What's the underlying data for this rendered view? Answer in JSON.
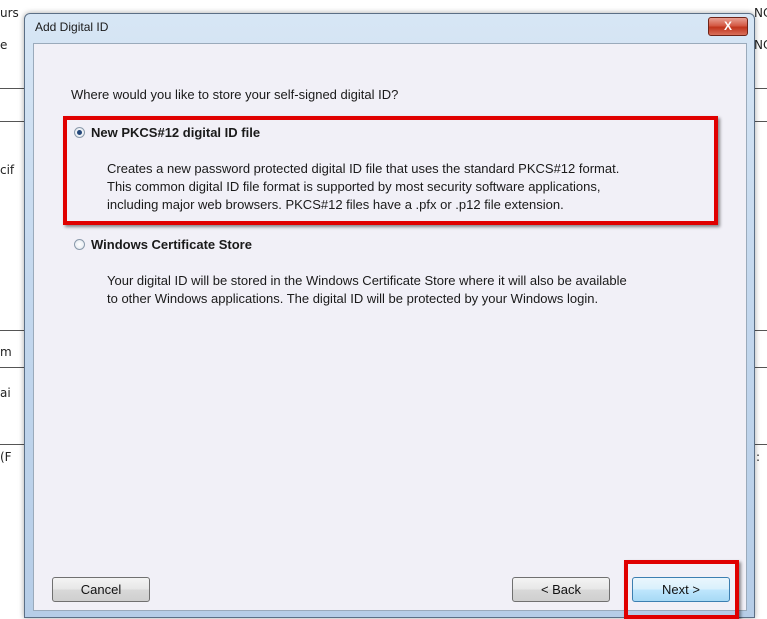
{
  "background": {
    "fragments_left": [
      "urs",
      "e",
      "cif",
      "m",
      "ai",
      "(F"
    ],
    "fragments_right": [
      "NC",
      "NC",
      ":"
    ]
  },
  "dialog": {
    "title": "Add Digital ID",
    "close_glyph": "X",
    "question": "Where would you like to store your self-signed digital ID?",
    "options": [
      {
        "label": "New PKCS#12 digital ID file",
        "selected": true,
        "description": [
          "Creates a new password protected digital ID file that uses the standard PKCS#12 format.",
          "This common digital ID file format is supported by most security software applications,",
          "including major web browsers. PKCS#12 files have a .pfx or .p12 file extension."
        ]
      },
      {
        "label": "Windows Certificate Store",
        "selected": false,
        "description": [
          "Your digital ID will be stored in the Windows Certificate Store where it will also be available",
          "to other Windows applications. The digital ID will be protected by your Windows login."
        ]
      }
    ],
    "buttons": {
      "cancel": "Cancel",
      "back": "< Back",
      "next": "Next >"
    },
    "highlight_color": "#e00000"
  }
}
